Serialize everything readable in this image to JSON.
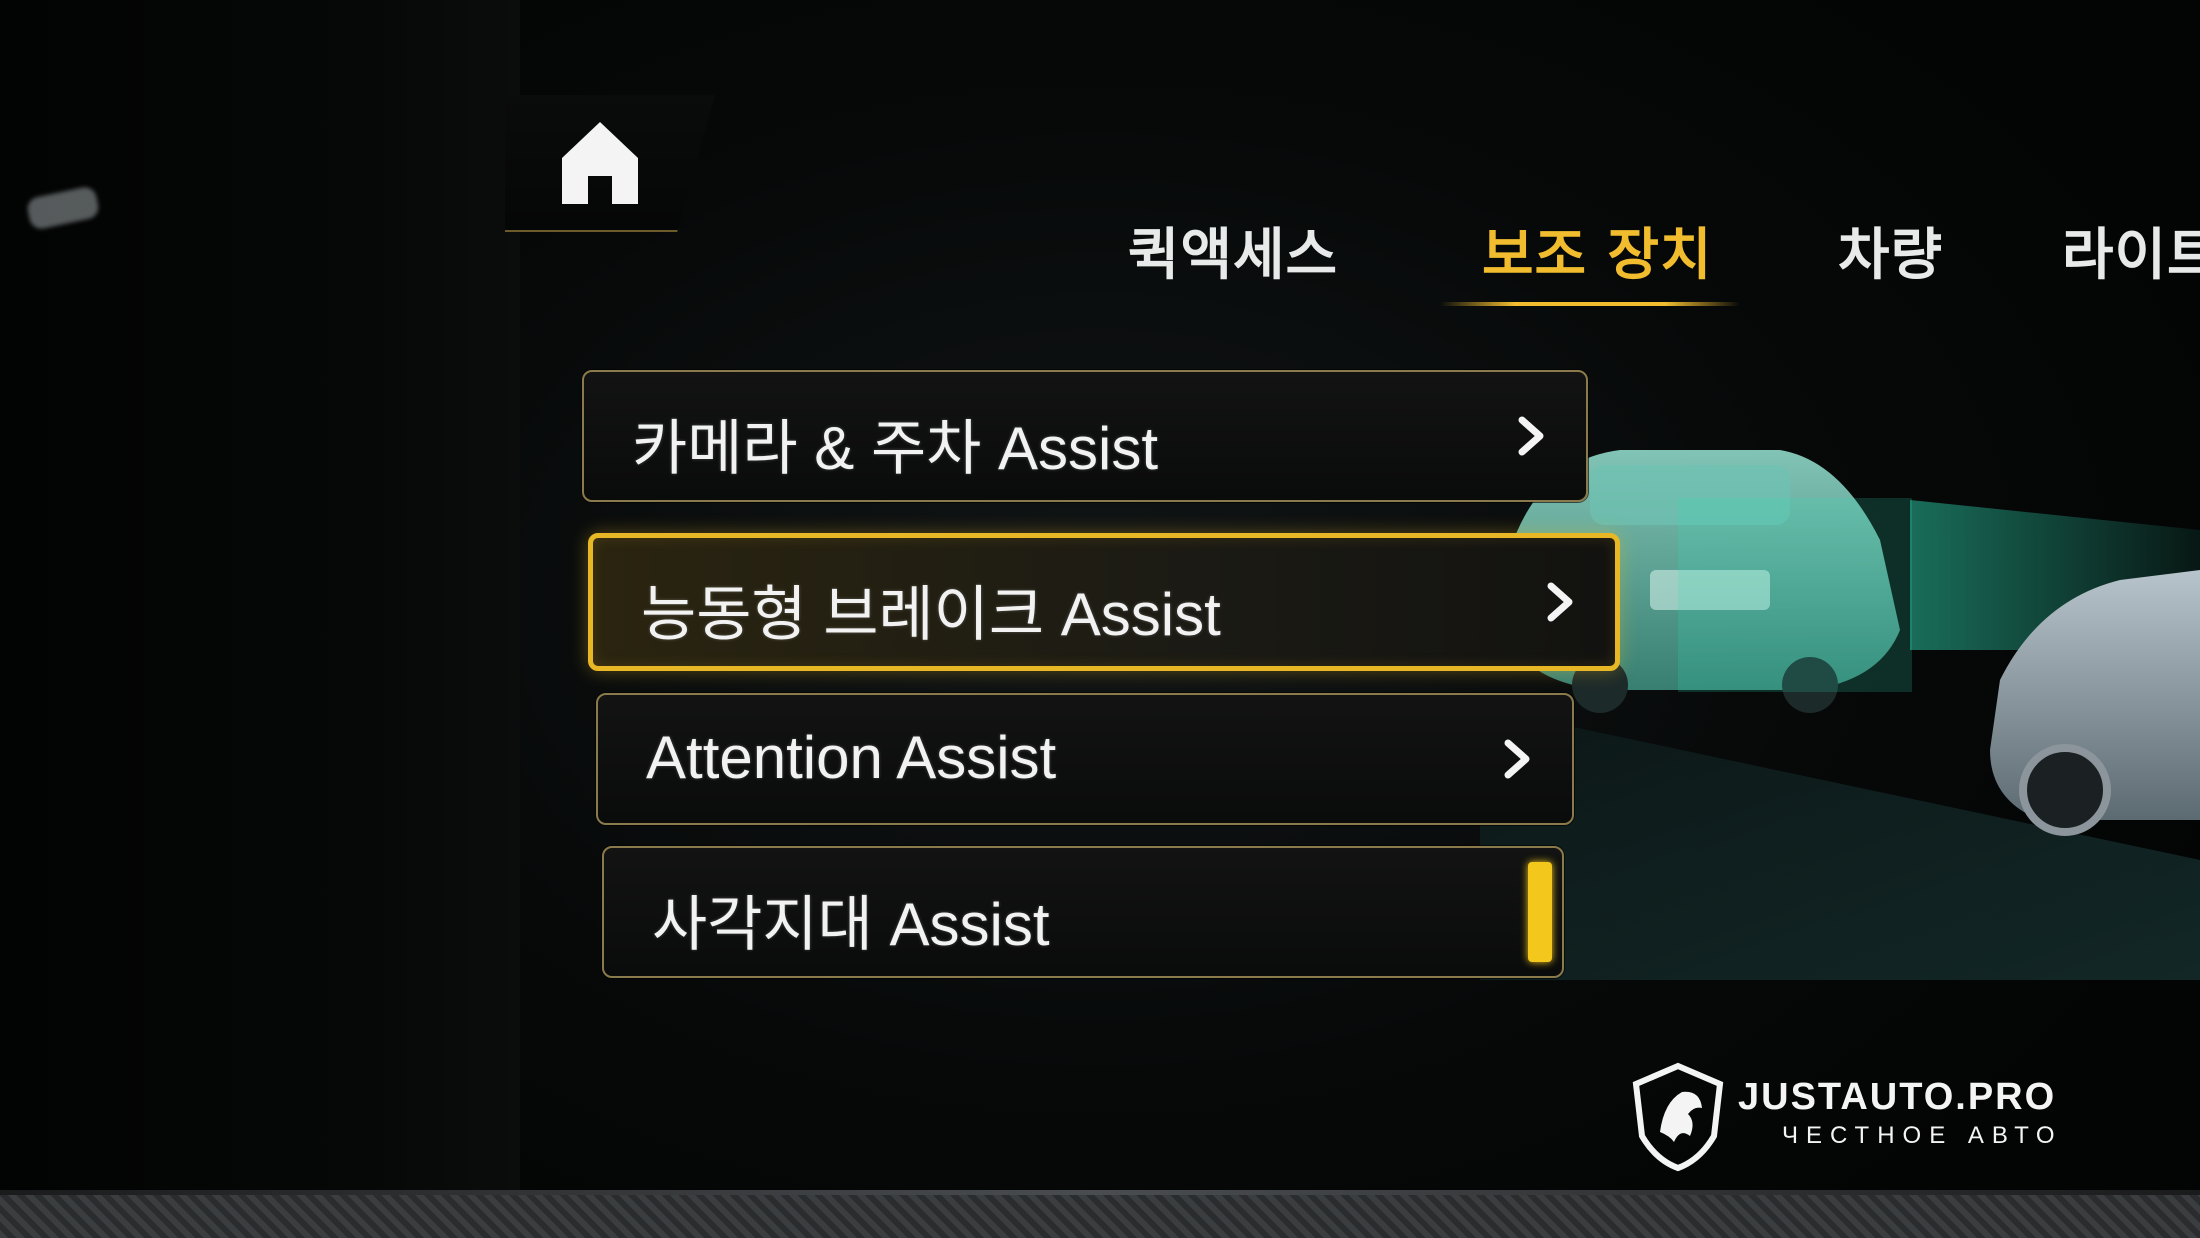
{
  "nav": {
    "tabs": [
      {
        "label": "퀵액세스",
        "active": false
      },
      {
        "label": "보조 장치",
        "active": true
      },
      {
        "label": "차량",
        "active": false
      },
      {
        "label": "라이트",
        "active": false
      }
    ]
  },
  "menu": {
    "items": [
      {
        "label": "카메라 & 주차 Assist",
        "control": "chevron-right-icon",
        "selected": false
      },
      {
        "label": "능동형 브레이크 Assist",
        "control": "chevron-right-icon",
        "selected": true
      },
      {
        "label": "Attention Assist",
        "control": "chevron-right-icon",
        "selected": false
      },
      {
        "label": "사각지대 Assist",
        "control": "toggle",
        "toggle_on": true,
        "selected": false
      }
    ]
  },
  "watermark": {
    "name": "JUSTAUTO.PRO",
    "tagline": "ЧЕСТНОЕ АВТО"
  },
  "colors": {
    "accent": "#f1bd2e",
    "toggle_on": "#f4c71c",
    "sensor_beam": "#2fe0b8",
    "background": "#070909"
  }
}
